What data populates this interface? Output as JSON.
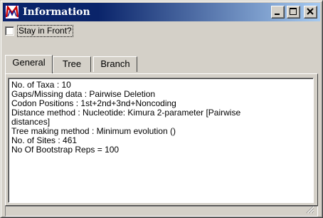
{
  "window": {
    "title": "Information",
    "icon": "mega-app-icon",
    "controls": [
      "minimize-icon",
      "maximize-icon",
      "close-icon"
    ]
  },
  "stay_in_front": {
    "label": "Stay in Front?",
    "checked": false
  },
  "tabs": [
    {
      "label": "General",
      "active": true
    },
    {
      "label": "Tree",
      "active": false
    },
    {
      "label": "Branch",
      "active": false
    }
  ],
  "info": {
    "lines": [
      "No. of Taxa : 10",
      "Gaps/Missing data : Pairwise Deletion",
      "Codon Positions : 1st+2nd+3nd+Noncoding",
      "Distance method : Nucleotide: Kimura 2-parameter  [Pairwise",
      "distances]",
      "Tree making method : Minimum evolution ()",
      "No. of Sites : 461",
      "No Of Bootstrap Reps = 100"
    ]
  },
  "colors": {
    "titlebar_start": "#0a246a",
    "titlebar_end": "#a6caf0",
    "face": "#d4d0c8",
    "content_bg": "#ffffff",
    "icon_red": "#cc0000"
  }
}
